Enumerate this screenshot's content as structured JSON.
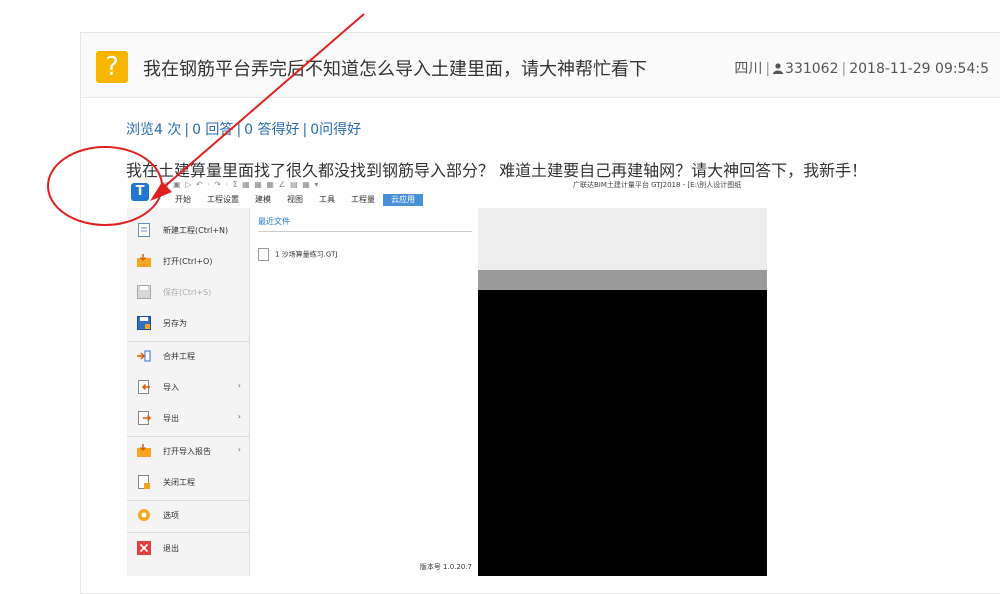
{
  "question": {
    "badge": "?",
    "title": "我在钢筋平台弄完后不知道怎么导入土建里面，请大神帮忙看下",
    "location": "四川",
    "user_id": "331062",
    "datetime": "2018-11-29 09:54:5"
  },
  "stats": {
    "views": "浏览4 次",
    "answers": "0 回答",
    "good_answers": "0 答得好",
    "good_questions": "0问得好"
  },
  "body": "我在土建算量里面找了很久都没找到钢筋导入部分？ 难道土建要自己再建轴网？请大神回答下，我新手！",
  "screenshot": {
    "logo": "T",
    "quick_access": "▤ ▣ ▷ ↶ · ↷ · Σ ▦ ▦ ▦ ∠ ▤ ▦ ▾",
    "app_title": "广联达BIM土建计量平台 GTJ2018 - [E:\\别人设计图纸",
    "tabs": [
      "开始",
      "工程设置",
      "建模",
      "视图",
      "工具",
      "工程量",
      "云应用"
    ],
    "menu": [
      {
        "label": "新建工程(Ctrl+N)",
        "disabled": false,
        "arrow": ""
      },
      {
        "label": "打开(Ctrl+O)",
        "disabled": false,
        "arrow": ""
      },
      {
        "label": "保存(Ctrl+S)",
        "disabled": true,
        "arrow": ""
      },
      {
        "label": "另存为",
        "disabled": false,
        "arrow": ""
      },
      {
        "label": "合并工程",
        "disabled": false,
        "arrow": ""
      },
      {
        "label": "导入",
        "disabled": false,
        "arrow": "›"
      },
      {
        "label": "导出",
        "disabled": false,
        "arrow": "›"
      },
      {
        "label": "打开导入报告",
        "disabled": false,
        "arrow": "›"
      },
      {
        "label": "关闭工程",
        "disabled": false,
        "arrow": ""
      },
      {
        "label": "选项",
        "disabled": false,
        "arrow": ""
      },
      {
        "label": "退出",
        "disabled": false,
        "arrow": ""
      }
    ],
    "recent_header": "最近文件",
    "recent_files": [
      "1 沙场算量练习.GTJ"
    ],
    "version": "版本号 1.0.20.7"
  },
  "colors": {
    "accent_blue": "#2a6cb0",
    "badge_yellow": "#f7b500",
    "annotation_red": "#e02020",
    "active_tab": "#4a90d9"
  }
}
